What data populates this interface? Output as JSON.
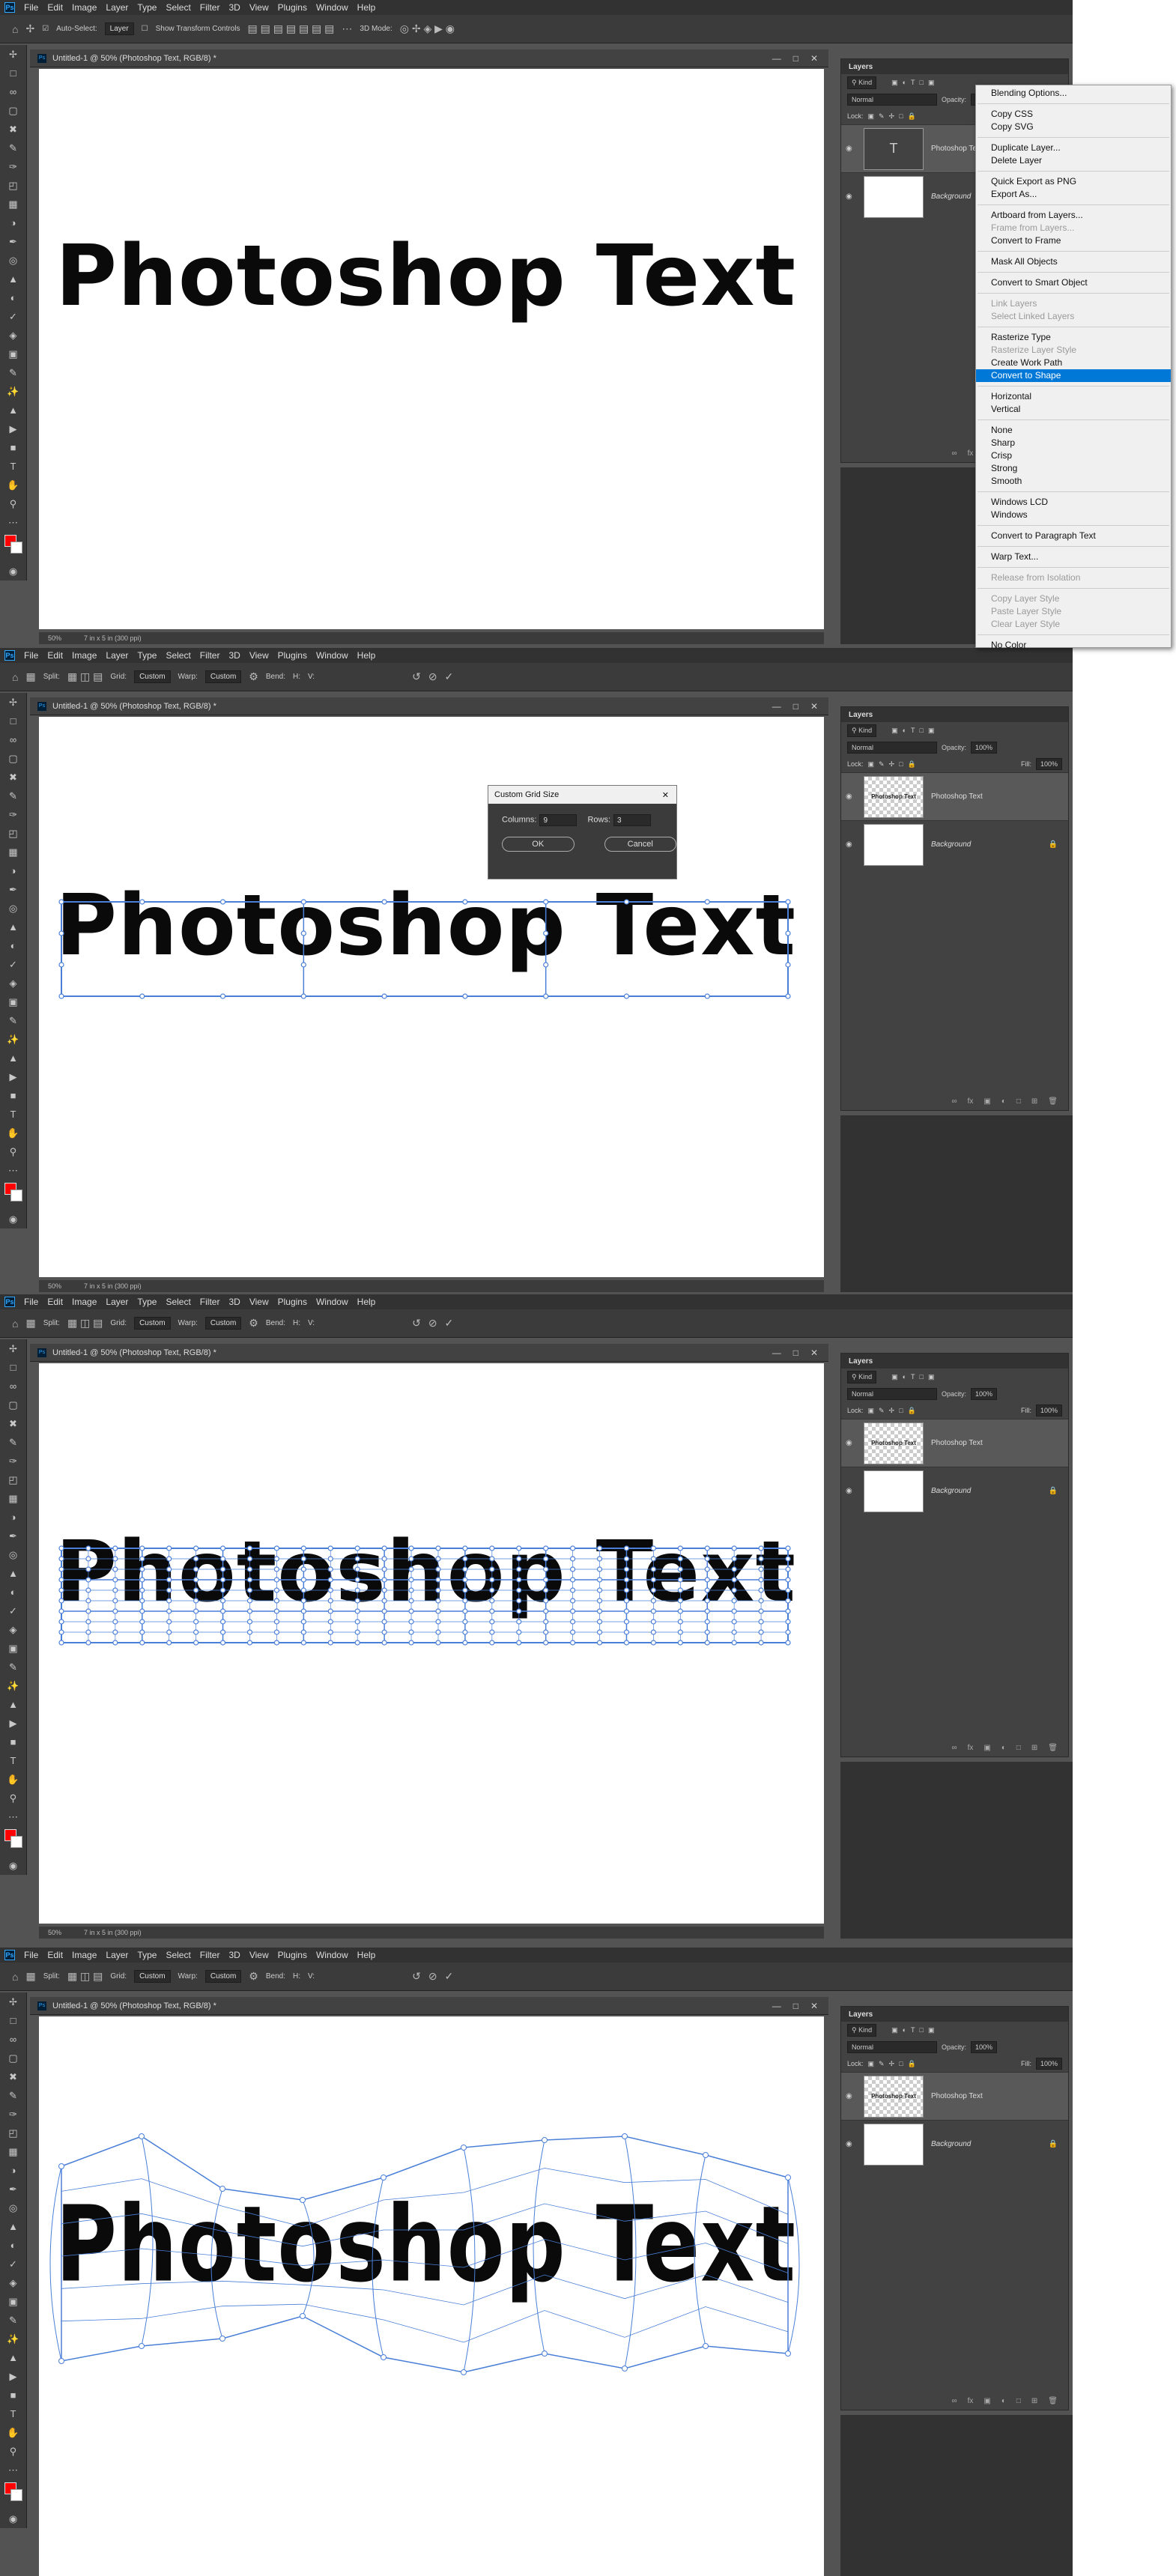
{
  "app": {
    "logo": "Ps"
  },
  "menu": [
    "File",
    "Edit",
    "Image",
    "Layer",
    "Type",
    "Select",
    "Filter",
    "3D",
    "View",
    "Plugins",
    "Window",
    "Help"
  ],
  "panel1_options": {
    "auto_select_label": "Auto-Select:",
    "auto_select_value": "Layer",
    "transform_label": "Show Transform Controls",
    "mode_label": "3D Mode:"
  },
  "warp_options": {
    "split_label": "Split:",
    "grid_label": "Grid:",
    "grid_value": "Custom",
    "warp_label": "Warp:",
    "warp_value": "Custom",
    "bend_label": "Bend:",
    "h_label": "H:",
    "v_label": "V:"
  },
  "document": {
    "title": "Untitled-1 @ 50% (Photoshop Text, RGB/8) *",
    "zoom": "50%",
    "doc_info": "7 in x 5 in (300 ppi)"
  },
  "canvas_text": "Photoshop Text",
  "layers_panel": {
    "tab": "Layers",
    "kind": "Kind",
    "blend": "Normal",
    "opacity_label": "Opacity:",
    "opacity_value": "100%",
    "lock_label": "Lock:",
    "fill_label": "Fill:",
    "fill_value": "100%",
    "layer_text": "Photoshop Text",
    "layer_bg": "Background",
    "type_thumb": "T"
  },
  "context_menu": {
    "items": [
      {
        "label": "Blending Options...",
        "state": "normal"
      },
      {
        "sep": true
      },
      {
        "label": "Copy CSS",
        "state": "normal"
      },
      {
        "label": "Copy SVG",
        "state": "normal"
      },
      {
        "sep": true
      },
      {
        "label": "Duplicate Layer...",
        "state": "normal"
      },
      {
        "label": "Delete Layer",
        "state": "normal"
      },
      {
        "sep": true
      },
      {
        "label": "Quick Export as PNG",
        "state": "normal"
      },
      {
        "label": "Export As...",
        "state": "normal"
      },
      {
        "sep": true
      },
      {
        "label": "Artboard from Layers...",
        "state": "normal"
      },
      {
        "label": "Frame from Layers...",
        "state": "disabled"
      },
      {
        "label": "Convert to Frame",
        "state": "normal"
      },
      {
        "sep": true
      },
      {
        "label": "Mask All Objects",
        "state": "normal"
      },
      {
        "sep": true
      },
      {
        "label": "Convert to Smart Object",
        "state": "normal"
      },
      {
        "sep": true
      },
      {
        "label": "Link Layers",
        "state": "disabled"
      },
      {
        "label": "Select Linked Layers",
        "state": "disabled"
      },
      {
        "sep": true
      },
      {
        "label": "Rasterize Type",
        "state": "normal"
      },
      {
        "label": "Rasterize Layer Style",
        "state": "disabled"
      },
      {
        "label": "Create Work Path",
        "state": "normal"
      },
      {
        "label": "Convert to Shape",
        "state": "highlighted"
      },
      {
        "sep": true
      },
      {
        "label": "Horizontal",
        "state": "normal"
      },
      {
        "label": "Vertical",
        "state": "normal"
      },
      {
        "sep": true
      },
      {
        "label": "None",
        "state": "normal"
      },
      {
        "label": "Sharp",
        "state": "normal"
      },
      {
        "label": "Crisp",
        "state": "normal"
      },
      {
        "label": "Strong",
        "state": "normal"
      },
      {
        "label": "Smooth",
        "state": "normal"
      },
      {
        "sep": true
      },
      {
        "label": "Windows LCD",
        "state": "normal"
      },
      {
        "label": "Windows",
        "state": "normal"
      },
      {
        "sep": true
      },
      {
        "label": "Convert to Paragraph Text",
        "state": "normal"
      },
      {
        "sep": true
      },
      {
        "label": "Warp Text...",
        "state": "normal"
      },
      {
        "sep": true
      },
      {
        "label": "Release from Isolation",
        "state": "disabled"
      },
      {
        "sep": true
      },
      {
        "label": "Copy Layer Style",
        "state": "disabled"
      },
      {
        "label": "Paste Layer Style",
        "state": "disabled"
      },
      {
        "label": "Clear Layer Style",
        "state": "disabled"
      },
      {
        "sep": true
      },
      {
        "label": "No Color",
        "state": "normal"
      }
    ]
  },
  "grid_dialog": {
    "title": "Custom Grid Size",
    "columns_label": "Columns:",
    "columns_value": "9",
    "rows_label": "Rows:",
    "rows_value": "3",
    "ok": "OK",
    "cancel": "Cancel"
  },
  "icons": [
    "home-icon",
    "move-tool-icon",
    "marquee-icon",
    "lasso-icon",
    "crop-icon",
    "eyedropper-icon",
    "brush-icon",
    "eraser-icon",
    "gradient-icon",
    "pen-icon",
    "type-tool-icon",
    "hand-icon",
    "zoom-icon",
    "ok-check-icon",
    "cancel-icon",
    "reset-warp-icon"
  ],
  "colors": {
    "foreground": "#ff0000",
    "background": "#ffffff",
    "grid": "#4a7fd8",
    "highlight": "#0078d7"
  }
}
